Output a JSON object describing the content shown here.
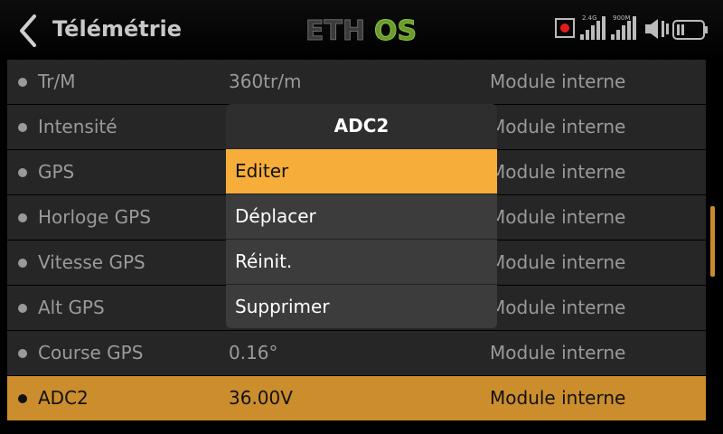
{
  "header": {
    "title": "Télémétrie",
    "logo_text_a": "ETH",
    "logo_text_b": "OS",
    "signal_a_label": "2.4G",
    "signal_b_label": "900M"
  },
  "rows": [
    {
      "name": "Tr/M",
      "value": "360tr/m",
      "source": "Module interne"
    },
    {
      "name": "Intensité",
      "value": "",
      "source": "Module interne"
    },
    {
      "name": "GPS",
      "value": "",
      "source": "Module interne"
    },
    {
      "name": "Horloge GPS",
      "value": "",
      "source": "Module interne"
    },
    {
      "name": "Vitesse GPS",
      "value": "",
      "source": "Module interne"
    },
    {
      "name": "Alt GPS",
      "value": "",
      "source": "Module interne"
    },
    {
      "name": "Course GPS",
      "value": "0.16°",
      "source": "Module interne"
    },
    {
      "name": "ADC2",
      "value": "36.00V",
      "source": "Module interne"
    }
  ],
  "popup": {
    "title": "ADC2",
    "items": [
      "Editer",
      "Déplacer",
      "Réinit.",
      "Supprimer"
    ]
  },
  "colors": {
    "accent": "#f6ad3a",
    "selected_row": "#cc8e2c",
    "logo_green": "#8dc63f"
  }
}
